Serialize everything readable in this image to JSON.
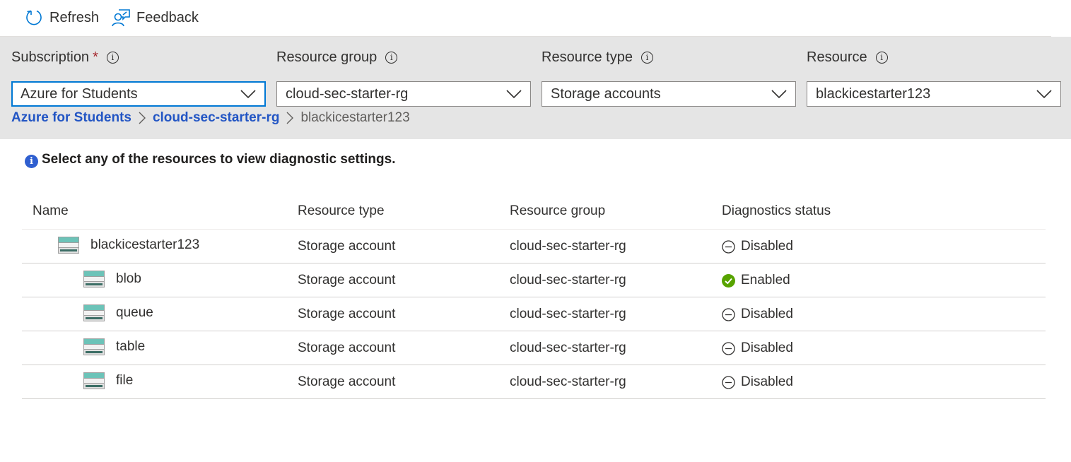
{
  "toolbar": {
    "refresh_label": "Refresh",
    "feedback_label": "Feedback"
  },
  "filters": {
    "subscription": {
      "label": "Subscription",
      "required_mark": "*",
      "value": "Azure for Students"
    },
    "resource_group": {
      "label": "Resource group",
      "value": "cloud-sec-starter-rg"
    },
    "resource_type": {
      "label": "Resource type",
      "value": "Storage accounts"
    },
    "resource": {
      "label": "Resource",
      "value": "blackicestarter123"
    }
  },
  "breadcrumb": {
    "items": [
      "Azure for Students",
      "cloud-sec-starter-rg"
    ],
    "current": "blackicestarter123"
  },
  "info_message": "Select any of the resources to view diagnostic settings.",
  "table": {
    "columns": [
      "Name",
      "Resource type",
      "Resource group",
      "Diagnostics status"
    ],
    "rows": [
      {
        "name": "blackicestarter123",
        "type": "Storage account",
        "group": "cloud-sec-starter-rg",
        "status": "Disabled",
        "level": 0
      },
      {
        "name": "blob",
        "type": "Storage account",
        "group": "cloud-sec-starter-rg",
        "status": "Enabled",
        "level": 1
      },
      {
        "name": "queue",
        "type": "Storage account",
        "group": "cloud-sec-starter-rg",
        "status": "Disabled",
        "level": 1
      },
      {
        "name": "table",
        "type": "Storage account",
        "group": "cloud-sec-starter-rg",
        "status": "Disabled",
        "level": 1
      },
      {
        "name": "file",
        "type": "Storage account",
        "group": "cloud-sec-starter-rg",
        "status": "Disabled",
        "level": 1
      }
    ]
  },
  "icons": {
    "refresh": "refresh-icon",
    "feedback": "feedback-icon",
    "storage": "storage-account-icon",
    "enabled": "check-circle-icon",
    "disabled": "minus-circle-icon"
  },
  "colors": {
    "accent": "#0078d4",
    "link": "#2255c4",
    "enabled": "#57a300",
    "filter_band": "#e5e5e5"
  }
}
